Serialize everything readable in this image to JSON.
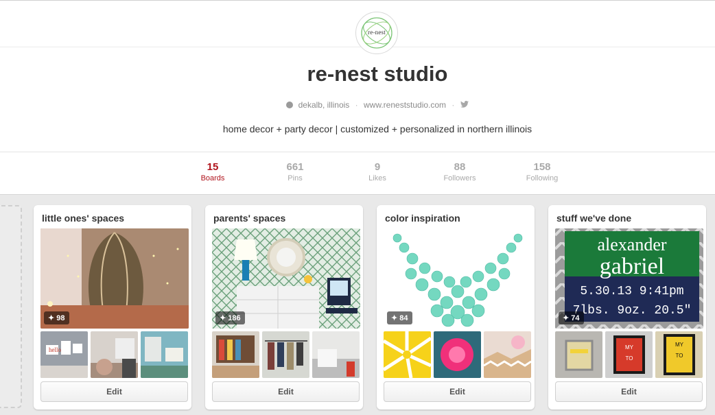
{
  "profile": {
    "avatar_text": "re-nest",
    "name": "re-nest studio",
    "location": "dekalb, illinois",
    "website": "www.reneststudio.com",
    "description": "home decor + party decor | customized + personalized in northern illinois"
  },
  "stats": [
    {
      "count": "15",
      "label": "Boards",
      "active": true
    },
    {
      "count": "661",
      "label": "Pins",
      "active": false
    },
    {
      "count": "9",
      "label": "Likes",
      "active": false
    },
    {
      "count": "88",
      "label": "Followers",
      "active": false
    },
    {
      "count": "158",
      "label": "Following",
      "active": false
    }
  ],
  "boards": [
    {
      "title": "little ones' spaces",
      "pin_count": "98",
      "edit_label": "Edit"
    },
    {
      "title": "parents' spaces",
      "pin_count": "186",
      "edit_label": "Edit"
    },
    {
      "title": "color inspiration",
      "pin_count": "84",
      "edit_label": "Edit"
    },
    {
      "title": "stuff we've done",
      "pin_count": "74",
      "edit_label": "Edit",
      "cover_text": [
        "alexander",
        "gabriel",
        "5.30.13 9:41pm",
        "7lbs. 9oz. 20.5\""
      ],
      "thumb_texts": [
        [
          "MY",
          "TO"
        ],
        [
          "MY",
          "TO"
        ]
      ]
    }
  ],
  "colors": {
    "accent": "#b0131c",
    "muted": "#a9a9a9"
  }
}
